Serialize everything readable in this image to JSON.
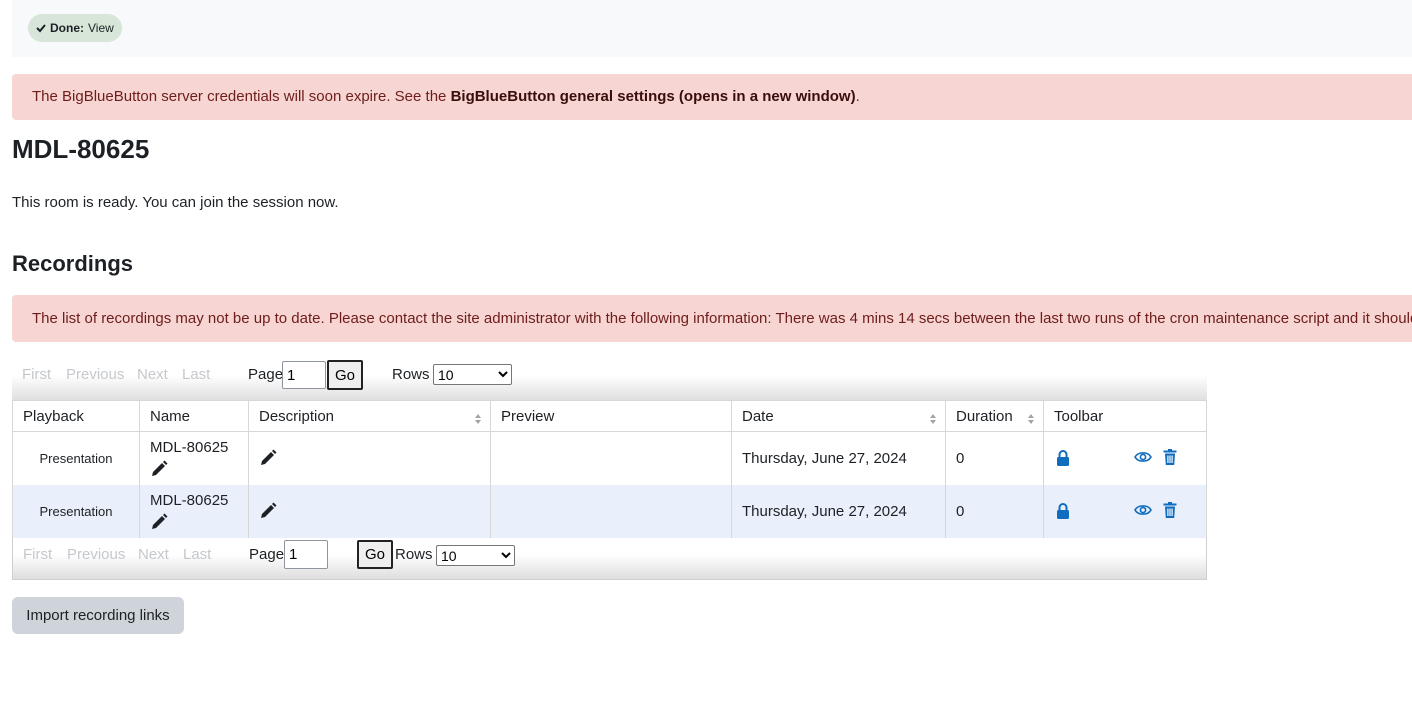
{
  "status": {
    "done_label": "Done:",
    "done_value": "View"
  },
  "alerts": {
    "credentials_prefix": "The BigBlueButton server credentials will soon expire. See the ",
    "credentials_link": "BigBlueButton general settings (opens in a new window)",
    "credentials_suffix": ".",
    "recordings_warning": "The list of recordings may not be up to date. Please contact the site administrator with the following information: There was 4 mins 14 secs between the last two runs of the cron maintenance script and it should"
  },
  "page": {
    "title": "MDL-80625",
    "room_status": "This room is ready. You can join the session now.",
    "recordings_heading": "Recordings"
  },
  "pager": {
    "first": "First",
    "previous": "Previous",
    "next": "Next",
    "last": "Last",
    "page_label": "Page",
    "page_value": "1",
    "go_label": "Go",
    "rows_label": "Rows",
    "rows_value": "10",
    "rows_options": [
      "10"
    ]
  },
  "table": {
    "headers": {
      "playback": "Playback",
      "name": "Name",
      "description": "Description",
      "preview": "Preview",
      "date": "Date",
      "duration": "Duration",
      "toolbar": "Toolbar"
    },
    "rows": [
      {
        "playback": "Presentation",
        "name": "MDL-80625",
        "description": "",
        "preview": "",
        "date": "Thursday, June 27, 2024",
        "duration": "0"
      },
      {
        "playback": "Presentation",
        "name": "MDL-80625",
        "description": "",
        "preview": "",
        "date": "Thursday, June 27, 2024",
        "duration": "0"
      }
    ]
  },
  "actions": {
    "import_label": "Import recording links"
  },
  "colors": {
    "alert_bg": "#f6d5d3",
    "alert_text": "#6e1d1b",
    "icon_blue": "#0f6cbf",
    "done_bg": "#d7e6d9",
    "alt_row": "#e9f0fb"
  },
  "icons": {
    "check": "check-icon",
    "edit": "pencil-icon",
    "lock": "lock-icon",
    "eye": "eye-icon",
    "trash": "trash-icon",
    "sort": "sort-icon"
  }
}
